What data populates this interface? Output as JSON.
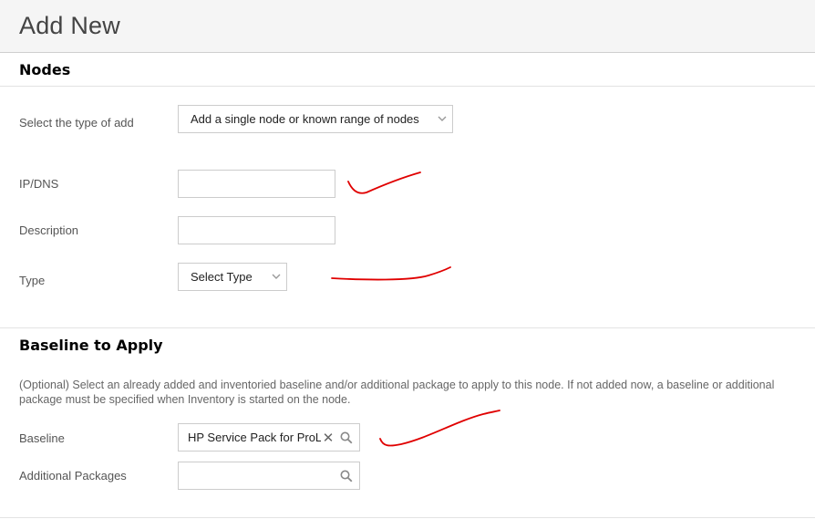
{
  "header": {
    "title": "Add New"
  },
  "nodes": {
    "section_title": "Nodes",
    "type_of_add": {
      "label": "Select the type of add",
      "value": "Add a single node or known range of nodes"
    },
    "ip_dns": {
      "label": "IP/DNS",
      "value": ""
    },
    "description": {
      "label": "Description",
      "value": ""
    },
    "type": {
      "label": "Type",
      "value": "Select Type"
    }
  },
  "baseline_section": {
    "section_title": "Baseline to Apply",
    "help_text": "(Optional) Select an already added and inventoried baseline and/or additional package to apply to this node. If not added now, a baseline or additional package must be specified when Inventory is started on the node.",
    "baseline": {
      "label": "Baseline",
      "value": "HP Service Pack for ProLiant"
    },
    "additional_packages": {
      "label": "Additional Packages",
      "value": ""
    }
  },
  "icons": {
    "dropdown": "chevron-down-icon",
    "search": "search-icon",
    "clear": "close-icon"
  },
  "colors": {
    "annotation": "#e00000",
    "header_bg": "#f5f5f5"
  }
}
